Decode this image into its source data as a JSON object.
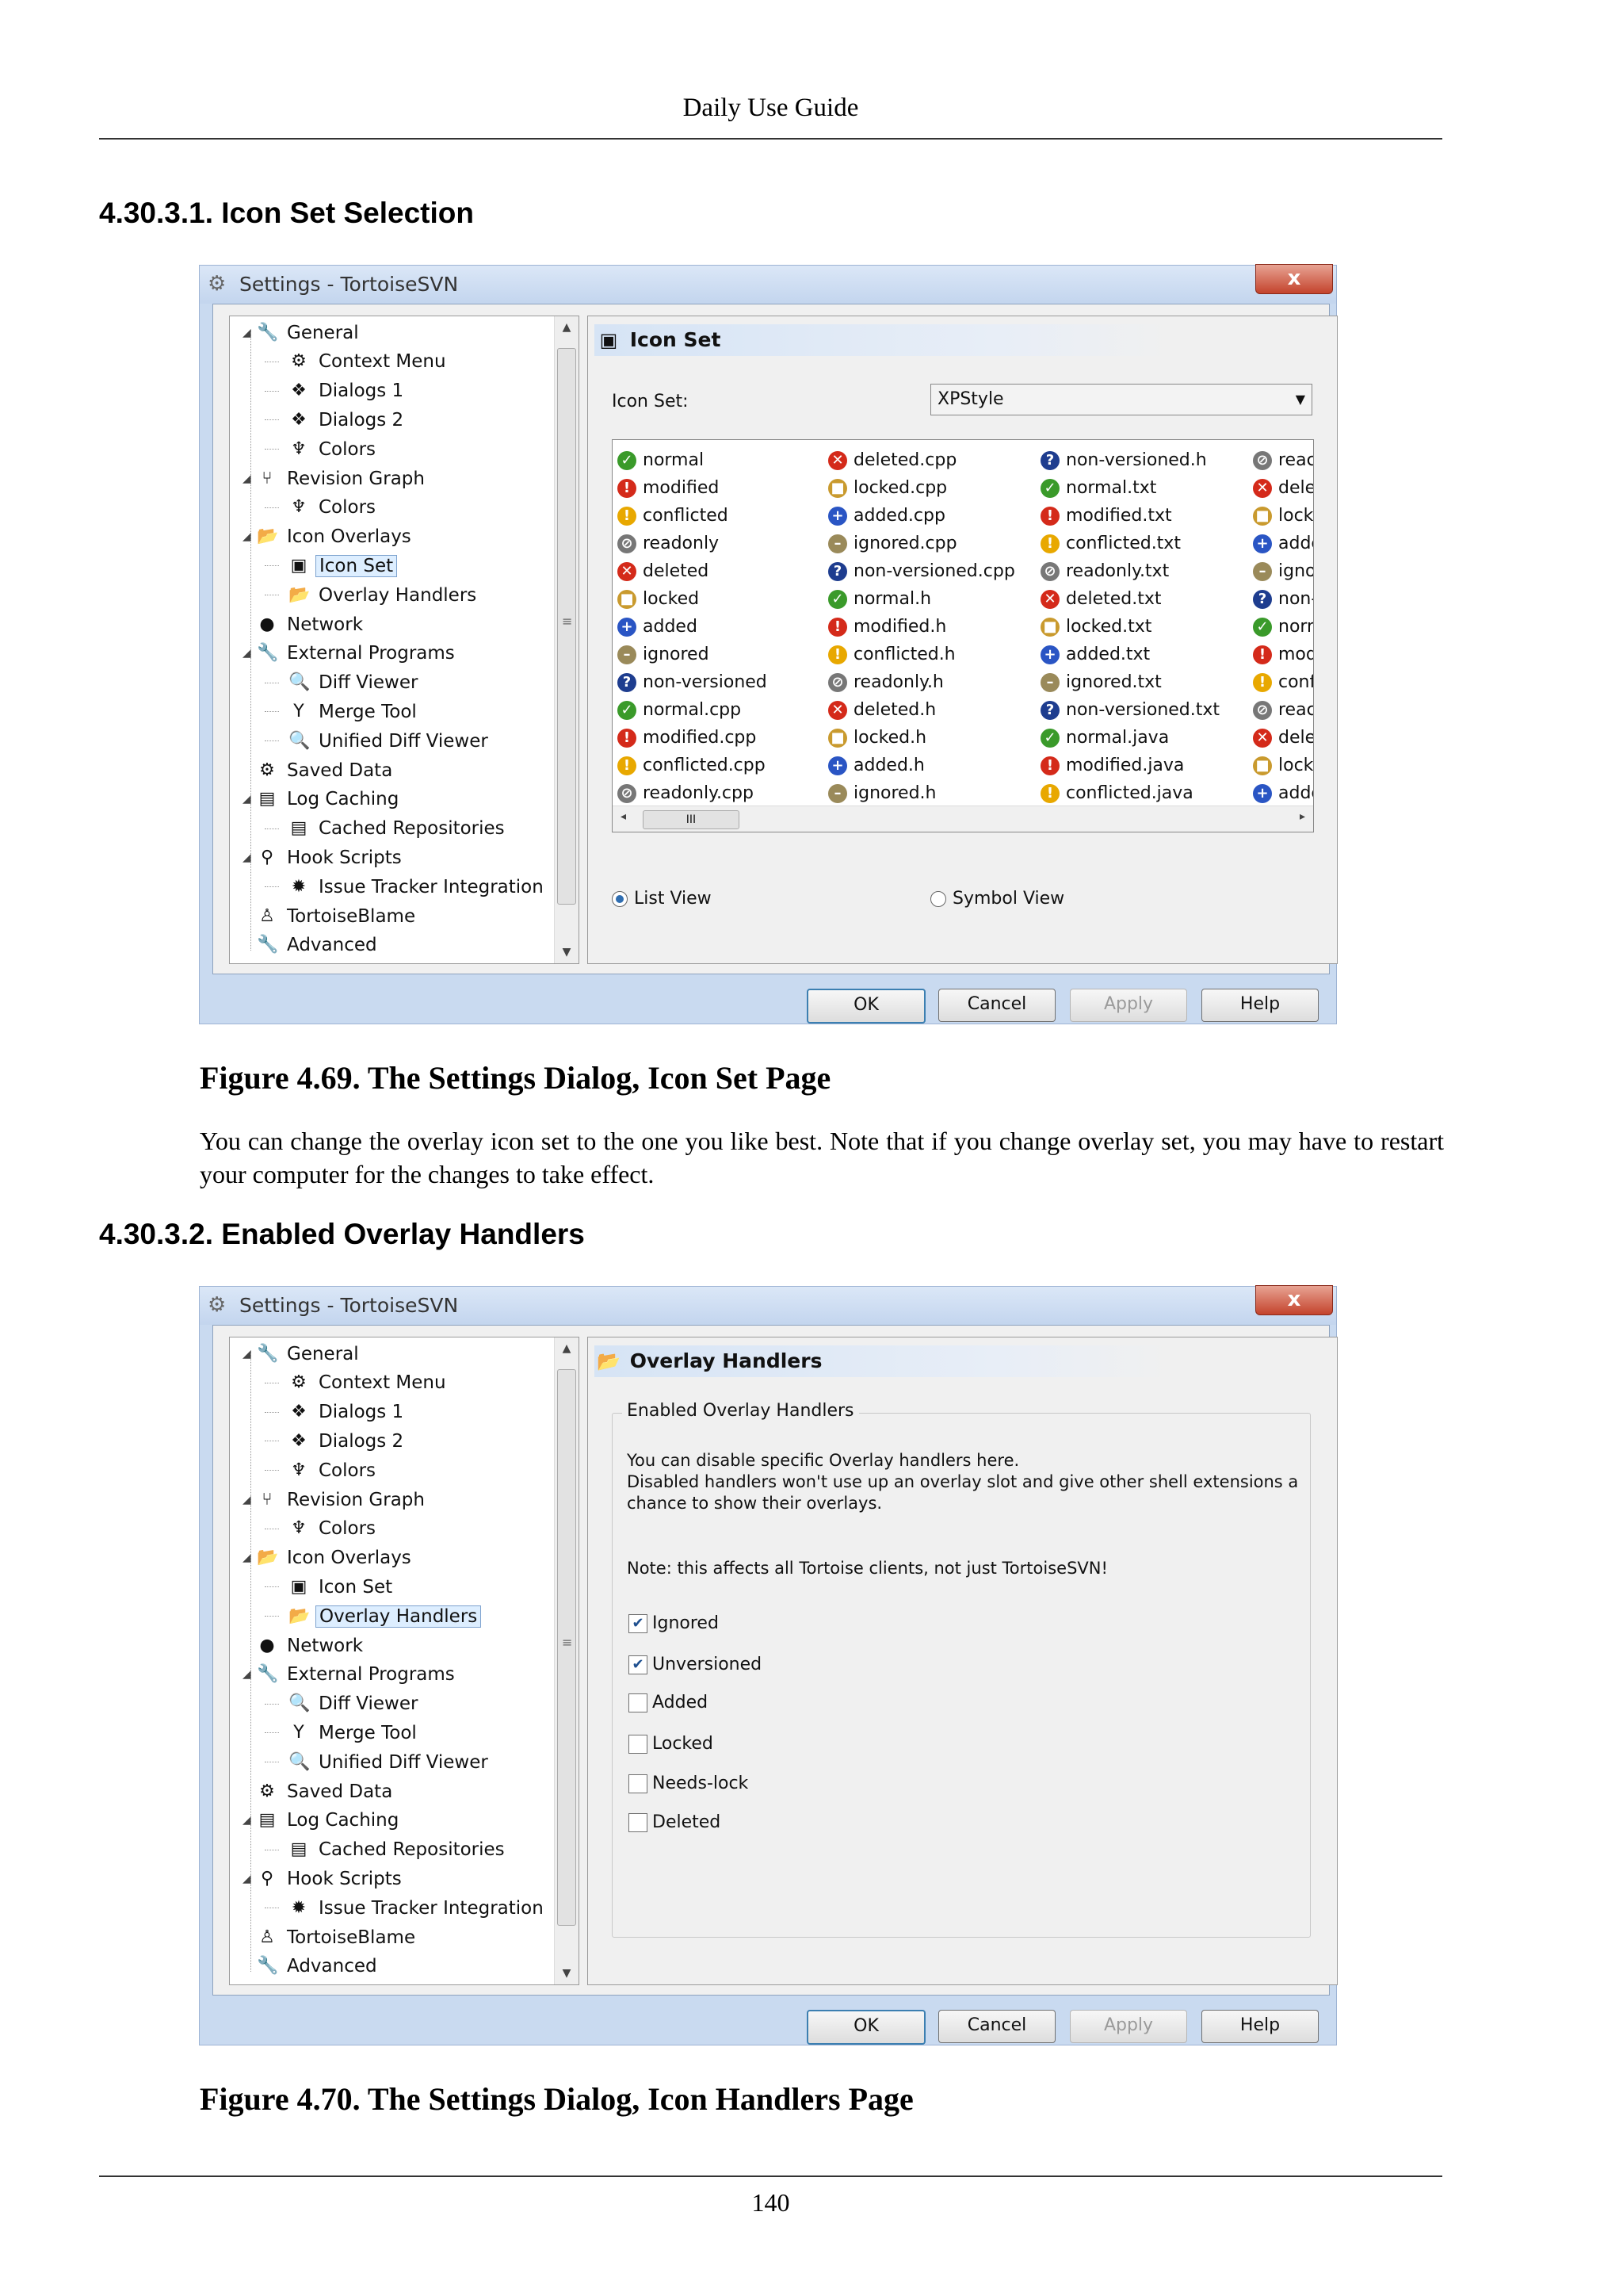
{
  "page": {
    "header": "Daily Use Guide",
    "page_number": "140"
  },
  "section1": {
    "title": "4.30.3.1. Icon Set Selection"
  },
  "section2": {
    "title": "4.30.3.2. Enabled Overlay Handlers"
  },
  "figure1": {
    "caption": "Figure 4.69. The Settings Dialog, Icon Set Page"
  },
  "figure2": {
    "caption": "Figure 4.70. The Settings Dialog, Icon Handlers Page"
  },
  "paragraph": "You can change the overlay icon set to the one you like best. Note that if you change overlay set, you may have to restart your computer for the changes to take effect.",
  "dialog": {
    "title": "Settings - TortoiseSVN",
    "close": "x",
    "buttons": {
      "ok": "OK",
      "cancel": "Cancel",
      "apply": "Apply",
      "help": "Help"
    },
    "tree": [
      {
        "label": "General",
        "level": 0,
        "icon": "wrench-icon",
        "glyph": "🔧"
      },
      {
        "label": "Context Menu",
        "level": 1,
        "icon": "gear-icon",
        "glyph": "⚙"
      },
      {
        "label": "Dialogs 1",
        "level": 1,
        "icon": "dialogs-icon",
        "glyph": "❖"
      },
      {
        "label": "Dialogs 2",
        "level": 1,
        "icon": "dialogs-icon",
        "glyph": "❖"
      },
      {
        "label": "Colors",
        "level": 1,
        "icon": "palette-icon",
        "glyph": "♆"
      },
      {
        "label": "Revision Graph",
        "level": 0,
        "icon": "revision-graph-icon",
        "glyph": "⑂"
      },
      {
        "label": "Colors",
        "level": 1,
        "icon": "palette-icon",
        "glyph": "♆"
      },
      {
        "label": "Icon Overlays",
        "level": 0,
        "icon": "folder-overlay-icon",
        "glyph": "📂"
      },
      {
        "label": "Icon Set",
        "level": 1,
        "icon": "icon-set-icon",
        "glyph": "▣"
      },
      {
        "label": "Overlay Handlers",
        "level": 1,
        "icon": "folder-overlay-icon",
        "glyph": "📂"
      },
      {
        "label": "Network",
        "level": 0,
        "icon": "globe-icon",
        "glyph": "●"
      },
      {
        "label": "External Programs",
        "level": 0,
        "icon": "wrench-icon",
        "glyph": "🔧"
      },
      {
        "label": "Diff Viewer",
        "level": 1,
        "icon": "magnifier-icon",
        "glyph": "🔍"
      },
      {
        "label": "Merge Tool",
        "level": 1,
        "icon": "merge-icon",
        "glyph": "Y"
      },
      {
        "label": "Unified Diff Viewer",
        "level": 1,
        "icon": "magnifier-icon",
        "glyph": "🔍"
      },
      {
        "label": "Saved Data",
        "level": 0,
        "icon": "gear-icon",
        "glyph": "⚙"
      },
      {
        "label": "Log Caching",
        "level": 0,
        "icon": "database-icon",
        "glyph": "▤"
      },
      {
        "label": "Cached Repositories",
        "level": 1,
        "icon": "database-icon",
        "glyph": "▤"
      },
      {
        "label": "Hook Scripts",
        "level": 0,
        "icon": "hook-icon",
        "glyph": "⚲"
      },
      {
        "label": "Issue Tracker Integration",
        "level": 1,
        "icon": "bug-icon",
        "glyph": "✹"
      },
      {
        "label": "TortoiseBlame",
        "level": 0,
        "icon": "user-icon",
        "glyph": "♙"
      },
      {
        "label": "Advanced",
        "level": 0,
        "icon": "wrench-icon",
        "glyph": "🔧"
      }
    ],
    "icon_set_page": {
      "heading": "Icon Set",
      "icon_set_label": "Icon Set:",
      "icon_set_value": "XPStyle",
      "list_columns": [
        [
          {
            "text": "normal",
            "icon": "normal-overlay-icon",
            "glyph": "✓",
            "color": "#3a9a2a"
          },
          {
            "text": "modified",
            "icon": "modified-overlay-icon",
            "glyph": "!",
            "color": "#d42a1a"
          },
          {
            "text": "conflicted",
            "icon": "conflicted-overlay-icon",
            "glyph": "!",
            "color": "#e8a800"
          },
          {
            "text": "readonly",
            "icon": "readonly-overlay-icon",
            "glyph": "⊘",
            "color": "#777777"
          },
          {
            "text": "deleted",
            "icon": "deleted-overlay-icon",
            "glyph": "✕",
            "color": "#d42a1a"
          },
          {
            "text": "locked",
            "icon": "locked-overlay-icon",
            "glyph": "■",
            "color": "#c99a2e"
          },
          {
            "text": "added",
            "icon": "added-overlay-icon",
            "glyph": "+",
            "color": "#2a55c4"
          },
          {
            "text": "ignored",
            "icon": "ignored-overlay-icon",
            "glyph": "–",
            "color": "#9a8a5a"
          },
          {
            "text": "non-versioned",
            "icon": "non-versioned-overlay-icon",
            "glyph": "?",
            "color": "#1e3d8f"
          },
          {
            "text": "normal.cpp",
            "icon": "normal-overlay-icon",
            "glyph": "✓",
            "color": "#3a9a2a"
          },
          {
            "text": "modified.cpp",
            "icon": "modified-overlay-icon",
            "glyph": "!",
            "color": "#d42a1a"
          },
          {
            "text": "conflicted.cpp",
            "icon": "conflicted-overlay-icon",
            "glyph": "!",
            "color": "#e8a800"
          },
          {
            "text": "readonly.cpp",
            "icon": "readonly-overlay-icon",
            "glyph": "⊘",
            "color": "#777777"
          }
        ],
        [
          {
            "text": "deleted.cpp",
            "icon": "deleted-overlay-icon",
            "glyph": "✕",
            "color": "#d42a1a"
          },
          {
            "text": "locked.cpp",
            "icon": "locked-overlay-icon",
            "glyph": "■",
            "color": "#c99a2e"
          },
          {
            "text": "added.cpp",
            "icon": "added-overlay-icon",
            "glyph": "+",
            "color": "#2a55c4"
          },
          {
            "text": "ignored.cpp",
            "icon": "ignored-overlay-icon",
            "glyph": "–",
            "color": "#9a8a5a"
          },
          {
            "text": "non-versioned.cpp",
            "icon": "non-versioned-overlay-icon",
            "glyph": "?",
            "color": "#1e3d8f"
          },
          {
            "text": "normal.h",
            "icon": "normal-overlay-icon",
            "glyph": "✓",
            "color": "#3a9a2a"
          },
          {
            "text": "modified.h",
            "icon": "modified-overlay-icon",
            "glyph": "!",
            "color": "#d42a1a"
          },
          {
            "text": "conflicted.h",
            "icon": "conflicted-overlay-icon",
            "glyph": "!",
            "color": "#e8a800"
          },
          {
            "text": "readonly.h",
            "icon": "readonly-overlay-icon",
            "glyph": "⊘",
            "color": "#777777"
          },
          {
            "text": "deleted.h",
            "icon": "deleted-overlay-icon",
            "glyph": "✕",
            "color": "#d42a1a"
          },
          {
            "text": "locked.h",
            "icon": "locked-overlay-icon",
            "glyph": "■",
            "color": "#c99a2e"
          },
          {
            "text": "added.h",
            "icon": "added-overlay-icon",
            "glyph": "+",
            "color": "#2a55c4"
          },
          {
            "text": "ignored.h",
            "icon": "ignored-overlay-icon",
            "glyph": "–",
            "color": "#9a8a5a"
          }
        ],
        [
          {
            "text": "non-versioned.h",
            "icon": "non-versioned-overlay-icon",
            "glyph": "?",
            "color": "#1e3d8f"
          },
          {
            "text": "normal.txt",
            "icon": "normal-overlay-icon",
            "glyph": "✓",
            "color": "#3a9a2a"
          },
          {
            "text": "modified.txt",
            "icon": "modified-overlay-icon",
            "glyph": "!",
            "color": "#d42a1a"
          },
          {
            "text": "conflicted.txt",
            "icon": "conflicted-overlay-icon",
            "glyph": "!",
            "color": "#e8a800"
          },
          {
            "text": "readonly.txt",
            "icon": "readonly-overlay-icon",
            "glyph": "⊘",
            "color": "#777777"
          },
          {
            "text": "deleted.txt",
            "icon": "deleted-overlay-icon",
            "glyph": "✕",
            "color": "#d42a1a"
          },
          {
            "text": "locked.txt",
            "icon": "locked-overlay-icon",
            "glyph": "■",
            "color": "#c99a2e"
          },
          {
            "text": "added.txt",
            "icon": "added-overlay-icon",
            "glyph": "+",
            "color": "#2a55c4"
          },
          {
            "text": "ignored.txt",
            "icon": "ignored-overlay-icon",
            "glyph": "–",
            "color": "#9a8a5a"
          },
          {
            "text": "non-versioned.txt",
            "icon": "non-versioned-overlay-icon",
            "glyph": "?",
            "color": "#1e3d8f"
          },
          {
            "text": "normal.java",
            "icon": "normal-overlay-icon",
            "glyph": "✓",
            "color": "#3a9a2a"
          },
          {
            "text": "modified.java",
            "icon": "modified-overlay-icon",
            "glyph": "!",
            "color": "#d42a1a"
          },
          {
            "text": "conflicted.java",
            "icon": "conflicted-overlay-icon",
            "glyph": "!",
            "color": "#e8a800"
          }
        ],
        [
          {
            "text": "reac",
            "icon": "readonly-overlay-icon",
            "glyph": "⊘",
            "color": "#777777"
          },
          {
            "text": "dele",
            "icon": "deleted-overlay-icon",
            "glyph": "✕",
            "color": "#d42a1a"
          },
          {
            "text": "locke",
            "icon": "locked-overlay-icon",
            "glyph": "■",
            "color": "#c99a2e"
          },
          {
            "text": "adde",
            "icon": "added-overlay-icon",
            "glyph": "+",
            "color": "#2a55c4"
          },
          {
            "text": "igno",
            "icon": "ignored-overlay-icon",
            "glyph": "–",
            "color": "#9a8a5a"
          },
          {
            "text": "non-",
            "icon": "non-versioned-overlay-icon",
            "glyph": "?",
            "color": "#1e3d8f"
          },
          {
            "text": "norn",
            "icon": "normal-overlay-icon",
            "glyph": "✓",
            "color": "#3a9a2a"
          },
          {
            "text": "mod",
            "icon": "modified-overlay-icon",
            "glyph": "!",
            "color": "#d42a1a"
          },
          {
            "text": "conf",
            "icon": "conflicted-overlay-icon",
            "glyph": "!",
            "color": "#e8a800"
          },
          {
            "text": "reac",
            "icon": "readonly-overlay-icon",
            "glyph": "⊘",
            "color": "#777777"
          },
          {
            "text": "dele",
            "icon": "deleted-overlay-icon",
            "glyph": "✕",
            "color": "#d42a1a"
          },
          {
            "text": "locke",
            "icon": "locked-overlay-icon",
            "glyph": "■",
            "color": "#c99a2e"
          },
          {
            "text": "adde",
            "icon": "added-overlay-icon",
            "glyph": "+",
            "color": "#2a55c4"
          }
        ]
      ],
      "scroll_thumb": "III",
      "radio_list": "List View",
      "radio_symbol": "Symbol View"
    },
    "overlay_page": {
      "heading": "Overlay Handlers",
      "group_title": "Enabled Overlay Handlers",
      "desc1": "You can disable specific Overlay handlers here.",
      "desc2": "Disabled handlers won't use up an overlay slot and give other shell extensions a",
      "desc3": "chance to show their overlays.",
      "note": "Note: this affects all Tortoise clients, not just TortoiseSVN!",
      "checkboxes": [
        {
          "label": "Ignored",
          "checked": true
        },
        {
          "label": "Unversioned",
          "checked": true
        },
        {
          "label": "Added",
          "checked": false
        },
        {
          "label": "Locked",
          "checked": false
        },
        {
          "label": "Needs-lock",
          "checked": false
        },
        {
          "label": "Deleted",
          "checked": false
        }
      ]
    }
  }
}
